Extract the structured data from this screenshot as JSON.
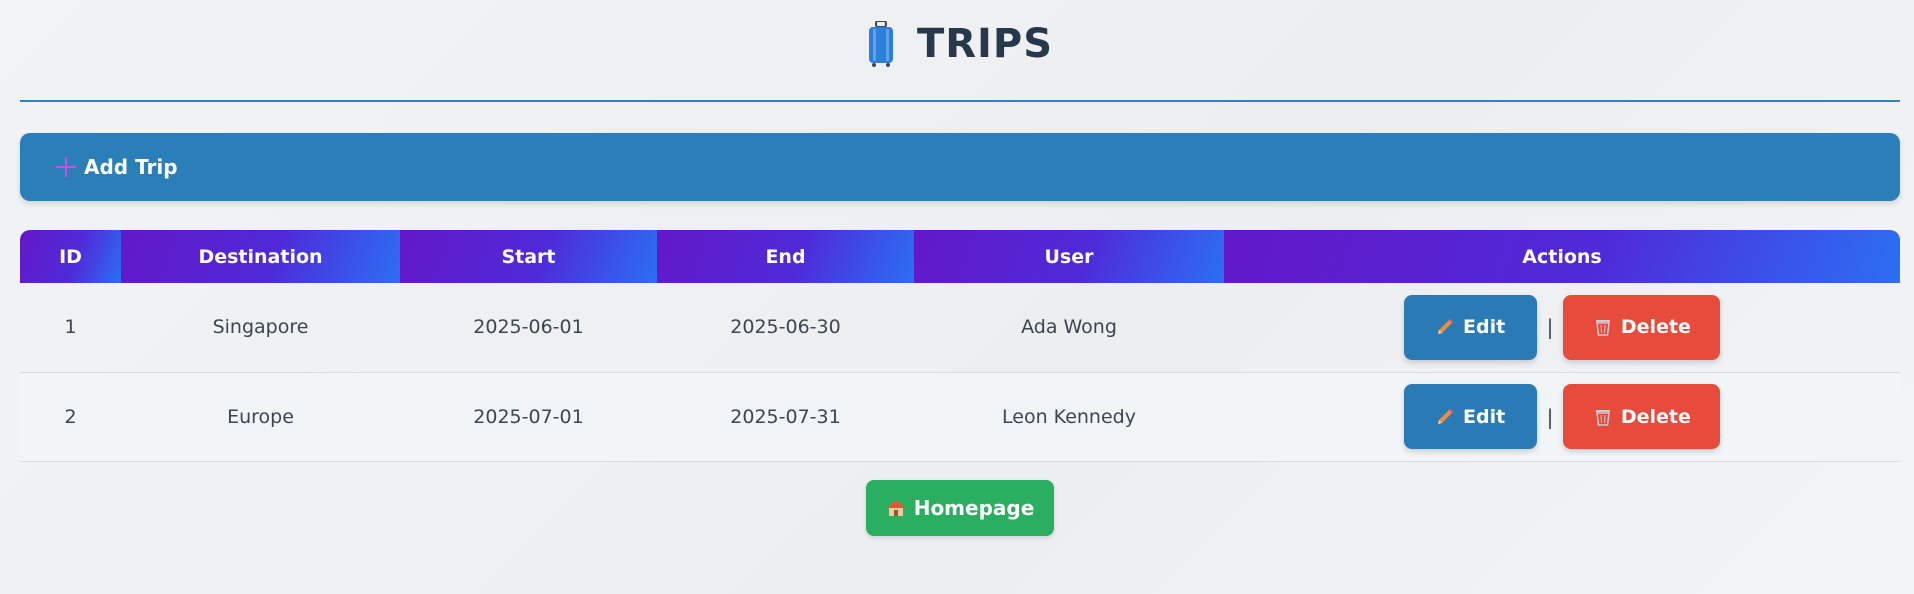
{
  "header": {
    "title": "TRIPS",
    "icon": "suitcase-icon"
  },
  "add_bar": {
    "label": "Add Trip",
    "icon": "plus-icon",
    "icon_color": "#c850e0",
    "bg": "#2a7fb8"
  },
  "table": {
    "columns": [
      "ID",
      "Destination",
      "Start",
      "End",
      "User",
      "Actions"
    ],
    "rows": [
      {
        "id": "1",
        "destination": "Singapore",
        "start": "2025-06-01",
        "end": "2025-06-30",
        "user": "Ada Wong"
      },
      {
        "id": "2",
        "destination": "Europe",
        "start": "2025-07-01",
        "end": "2025-07-31",
        "user": "Leon Kennedy"
      }
    ],
    "edit_label": "Edit",
    "delete_label": "Delete",
    "separator": "|"
  },
  "home_button": {
    "label": "Homepage",
    "icon": "house-icon",
    "bg": "#2aae5f"
  },
  "colors": {
    "accent": "#2a7fb8",
    "delete": "#e64b3c",
    "header_gradient_start": "#6318c8",
    "header_gradient_end": "#2b6ff4"
  }
}
